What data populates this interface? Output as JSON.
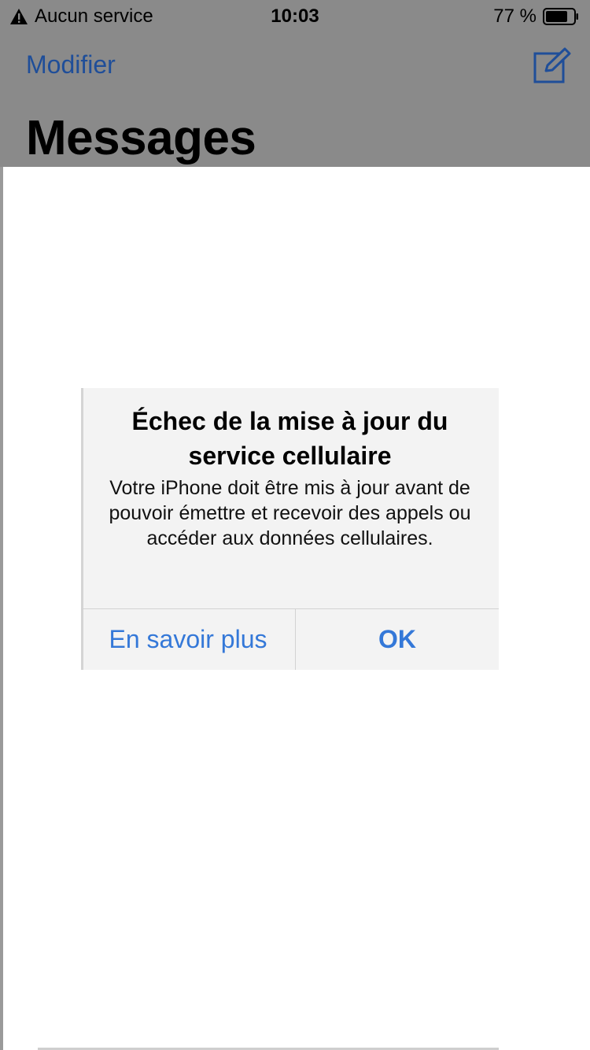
{
  "status_bar": {
    "carrier": "Aucun service",
    "time": "10:03",
    "battery": "77 %"
  },
  "nav": {
    "edit_label": "Modifier",
    "compose_icon": "compose-icon",
    "title": "Messages"
  },
  "alert": {
    "title": "Échec de la mise à jour du service cellulaire",
    "message": "Votre iPhone doit être mis à jour avant de pouvoir émettre et recevoir des appels ou accéder aux données cellulaires.",
    "button_secondary": "En savoir plus",
    "button_primary": "OK"
  },
  "colors": {
    "accent": "#3478d8",
    "nav_link": "#1f4e99",
    "dim_overlay": "#8a8a8a"
  }
}
